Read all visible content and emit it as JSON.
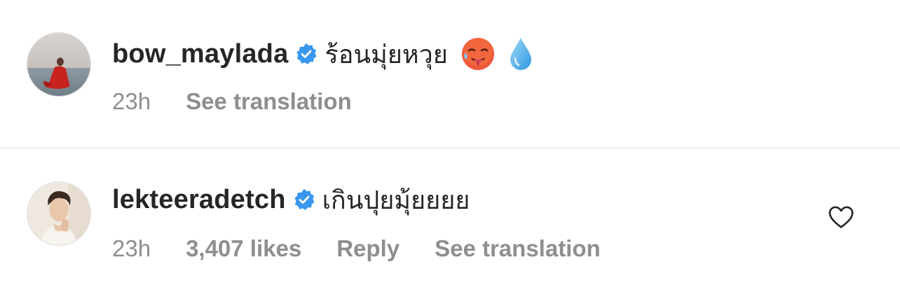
{
  "comments": [
    {
      "username": "bow_maylada",
      "text": "ร้อนมุ่ยหวุย",
      "emojis": [
        "hot-face-emoji",
        "droplet-emoji"
      ],
      "time": "23h",
      "see_translation": "See translation",
      "verified": true
    },
    {
      "username": "lekteeradetch",
      "text": "เกินปุยมุ้ยยยย",
      "time": "23h",
      "likes": "3,407 likes",
      "reply": "Reply",
      "see_translation": "See translation",
      "verified": true,
      "like_icon": "heart-outline-icon"
    }
  ],
  "colors": {
    "verified_blue": "#3897f0",
    "meta_gray": "#8e8e8e",
    "text_dark": "#262626"
  }
}
